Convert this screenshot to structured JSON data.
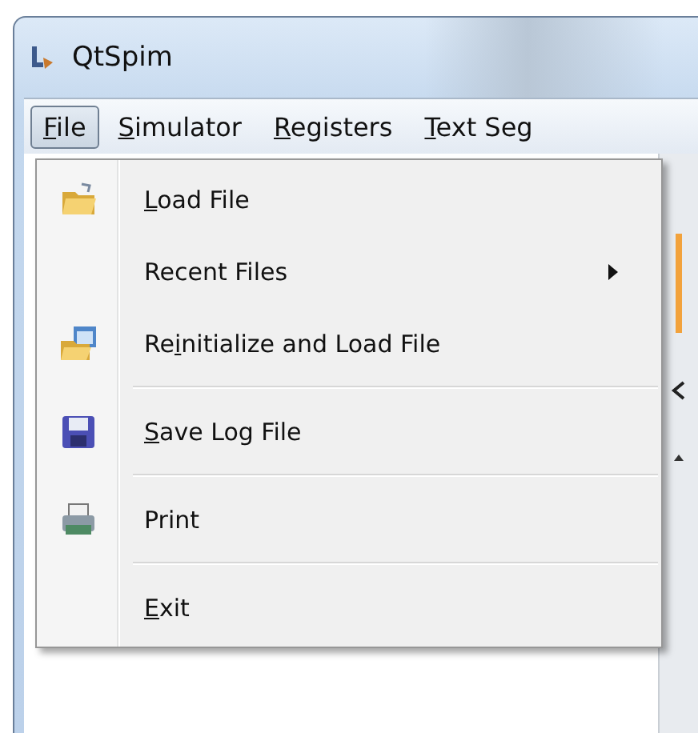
{
  "window": {
    "title": "QtSpim"
  },
  "menu_bar": [
    {
      "key": "F",
      "suffix": "ile",
      "selected": true
    },
    {
      "key": "S",
      "suffix": "imulator",
      "selected": false
    },
    {
      "key": "R",
      "suffix": "egisters",
      "selected": false
    },
    {
      "key": "T",
      "suffix": "ext Seg",
      "selected": false
    }
  ],
  "file_menu": [
    {
      "kind": "item",
      "key": "L",
      "suffix": "oad File"
    },
    {
      "kind": "submenu",
      "prefix": "Recent Files"
    },
    {
      "kind": "item",
      "prefix": "Re",
      "key": "i",
      "suffix": "nitialize and Load File"
    },
    {
      "kind": "separator"
    },
    {
      "kind": "item",
      "key": "S",
      "suffix": "ave Log File"
    },
    {
      "kind": "separator"
    },
    {
      "kind": "item",
      "prefix": "Print"
    },
    {
      "kind": "separator"
    },
    {
      "kind": "item",
      "key": "E",
      "suffix": "xit"
    }
  ]
}
